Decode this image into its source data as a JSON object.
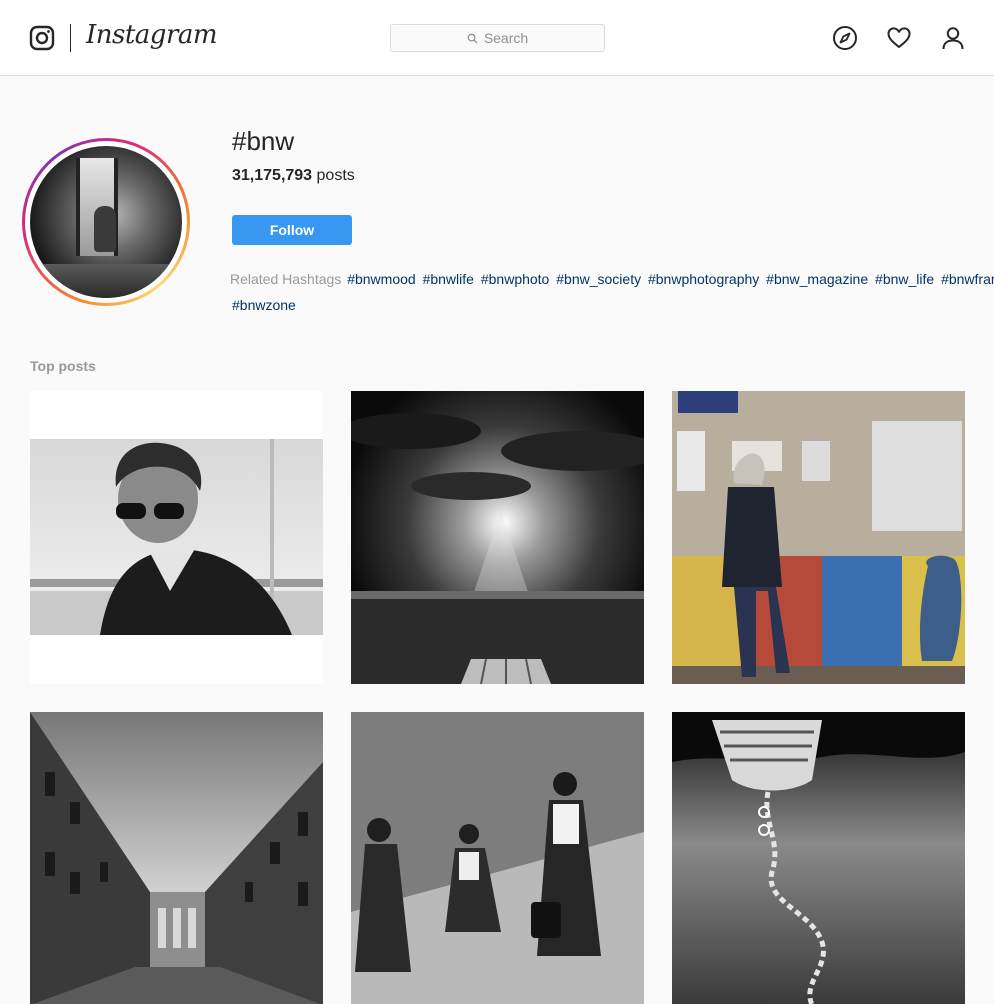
{
  "header": {
    "wordmark": "Instagram",
    "search_placeholder": "Search",
    "icons": [
      "instagram-glyph-icon",
      "search-icon",
      "compass-icon",
      "heart-icon",
      "profile-icon"
    ]
  },
  "hashtag": {
    "title": "#bnw",
    "post_count": "31,175,793",
    "post_suffix": " posts",
    "follow_label": "Follow",
    "follow_color": "#3897f0"
  },
  "related": {
    "label": "Related Hashtags",
    "tags": [
      "#bnwmood",
      "#bnwlife",
      "#bnwphoto",
      "#bnw_society",
      "#bnwphotography",
      "#bnw_magazine",
      "#bnw_life",
      "#bnwframing",
      "#bnwzone"
    ]
  },
  "top_posts": {
    "label": "Top posts",
    "items": [
      {
        "subject": "portrait-elderly-woman"
      },
      {
        "subject": "sunburst-clouds-landscape"
      },
      {
        "subject": "man-walking-poster-wall"
      },
      {
        "subject": "courtyard-buildings"
      },
      {
        "subject": "schoolgirls-walking"
      },
      {
        "subject": "boat-rope-reflection"
      }
    ]
  }
}
